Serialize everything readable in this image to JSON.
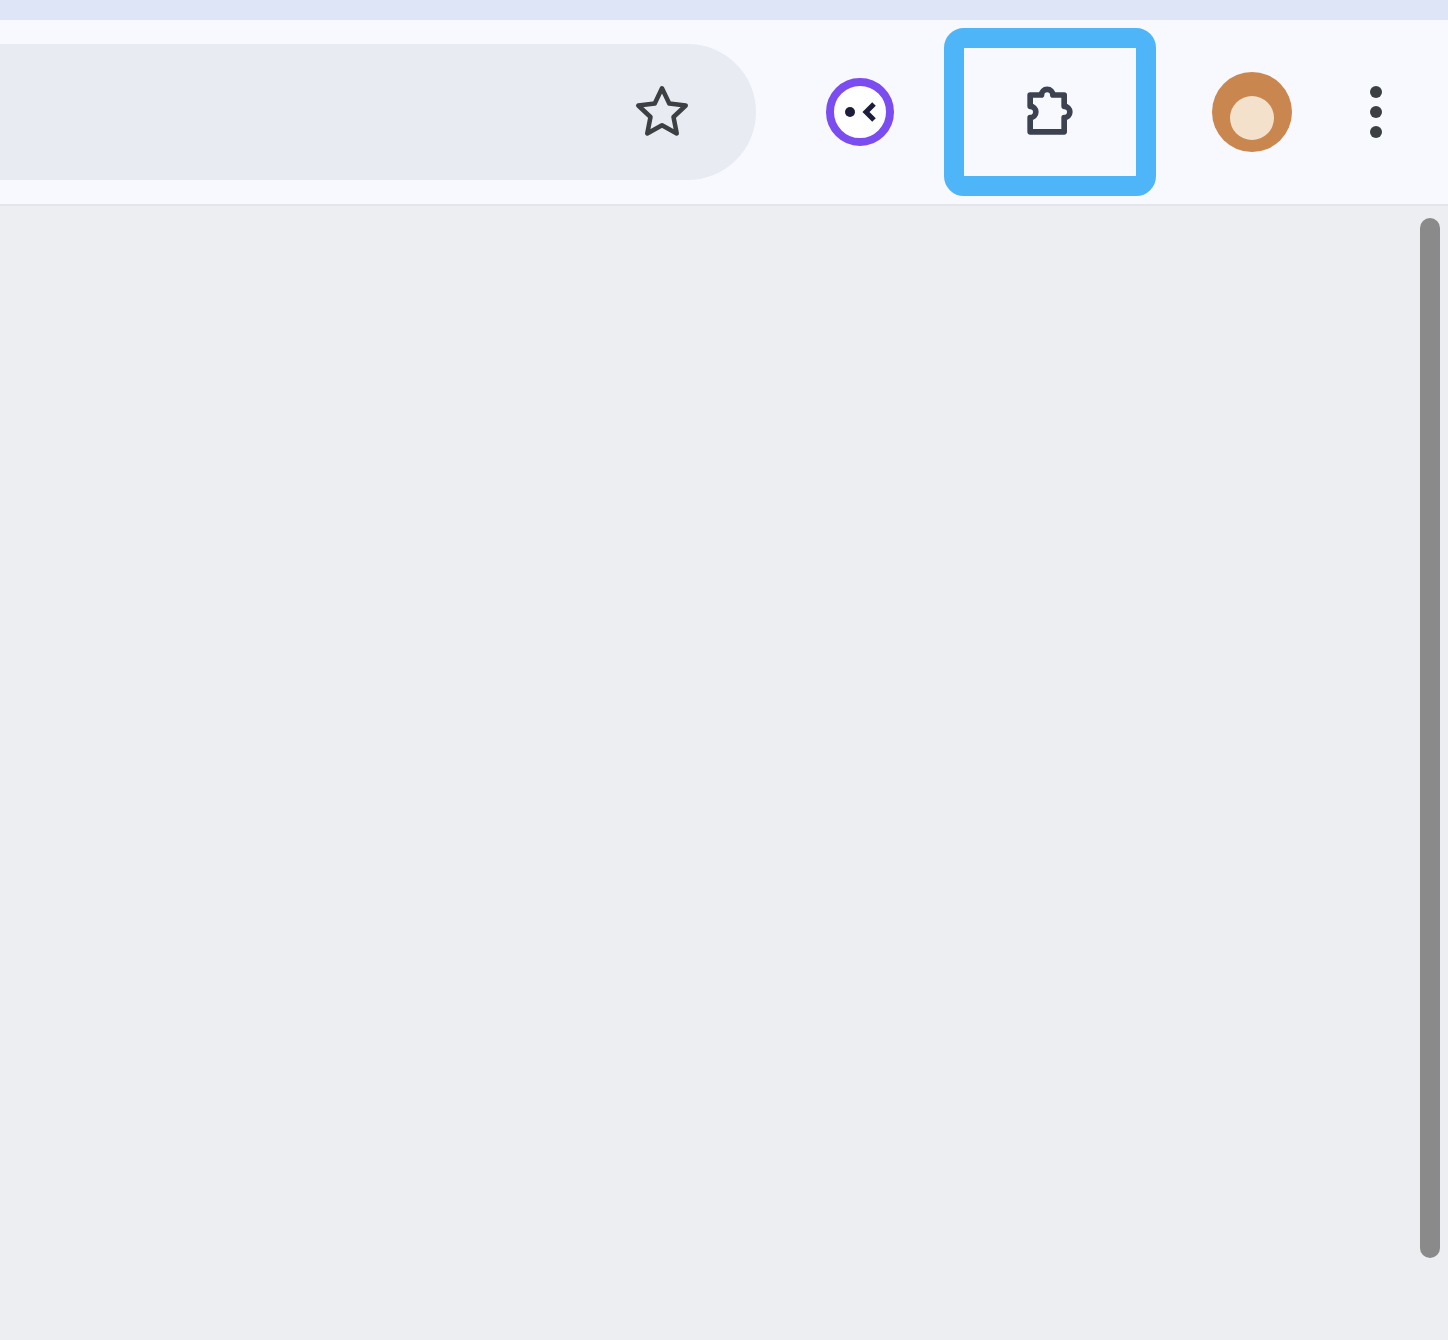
{
  "toolbar": {
    "address_bar": {
      "bookmarked": false
    },
    "items": [
      {
        "kind": "extension",
        "selected": false
      },
      {
        "kind": "extensions",
        "selected": true
      },
      {
        "kind": "profile",
        "selected": false
      },
      {
        "kind": "menu",
        "selected": false
      }
    ]
  }
}
